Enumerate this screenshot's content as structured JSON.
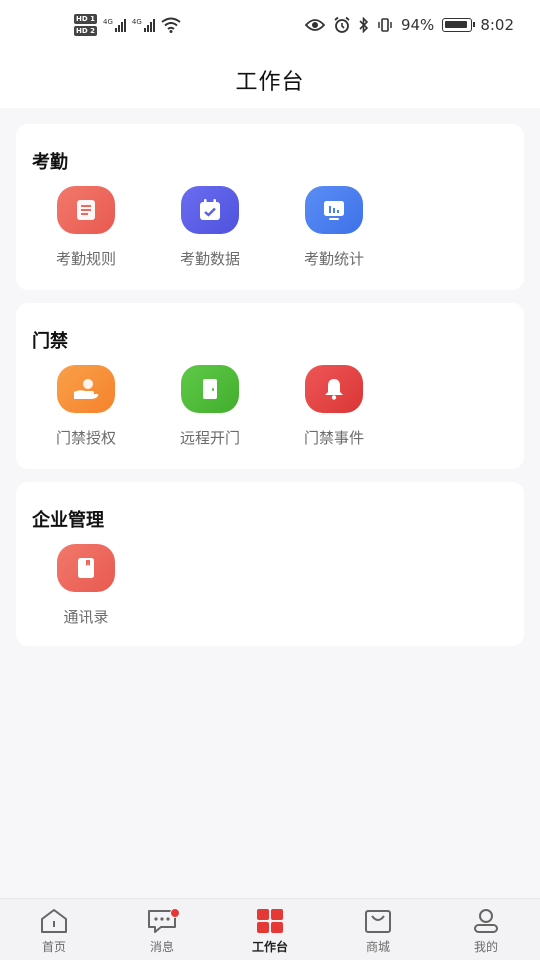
{
  "status_bar": {
    "sim1": "HD 1",
    "sim2": "HD 2",
    "net1": "4G",
    "net2": "4G",
    "battery_pct": "94%",
    "time": "8:02"
  },
  "header": {
    "title": "工作台"
  },
  "sections": [
    {
      "title": "考勤",
      "items": [
        {
          "label": "考勤规则",
          "icon": "document-icon",
          "color": "#ee6a5f"
        },
        {
          "label": "考勤数据",
          "icon": "calendar-check-icon",
          "color": "#5b5ee6"
        },
        {
          "label": "考勤统计",
          "icon": "bar-chart-icon",
          "color": "#4a7ff0"
        }
      ]
    },
    {
      "title": "门禁",
      "items": [
        {
          "label": "门禁授权",
          "icon": "hand-card-icon",
          "color": "#f7913a"
        },
        {
          "label": "远程开门",
          "icon": "door-icon",
          "color": "#52bd3a"
        },
        {
          "label": "门禁事件",
          "icon": "bell-icon",
          "color": "#e54343"
        }
      ]
    },
    {
      "title": "企业管理",
      "items": [
        {
          "label": "通讯录",
          "icon": "contact-book-icon",
          "color": "#ee6a5f"
        }
      ]
    }
  ],
  "bottom_nav": [
    {
      "label": "首页",
      "icon": "home-icon",
      "active": false
    },
    {
      "label": "消息",
      "icon": "message-icon",
      "active": false,
      "badge": true
    },
    {
      "label": "工作台",
      "icon": "grid-icon",
      "active": true
    },
    {
      "label": "商城",
      "icon": "shopping-bag-icon",
      "active": false
    },
    {
      "label": "我的",
      "icon": "user-icon",
      "active": false
    }
  ],
  "colors": {
    "accent": "#e53935",
    "text_secondary": "#6b6b6b",
    "background": "#f7f7f9"
  }
}
